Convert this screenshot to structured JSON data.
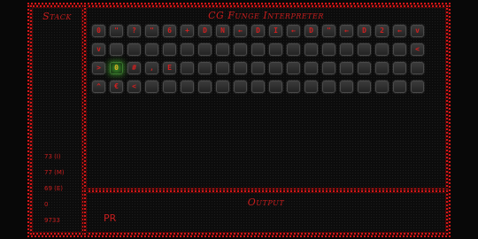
{
  "stack": {
    "title": "Stack",
    "values": [
      "73 (I)",
      "77 (M)",
      "69 (E)",
      "0",
      "9733"
    ]
  },
  "interpreter": {
    "title": "CG Funge Interpreter",
    "rows": [
      [
        "0",
        "\"",
        "?",
        "\"",
        "6",
        "+",
        "D",
        "N",
        "←",
        "D",
        "I",
        "←",
        "D",
        "\"",
        "←",
        "D",
        "2",
        "←",
        "v"
      ],
      [
        "v",
        "",
        "",
        "",
        "",
        "",
        "",
        "",
        "",
        "",
        "",
        "",
        "",
        "",
        "",
        "",
        "",
        "",
        "<"
      ],
      [
        ">",
        "0",
        "#",
        ",",
        "E",
        "",
        "",
        "",
        "",
        "",
        "",
        "",
        "",
        "",
        "",
        "",
        "",
        "",
        ""
      ],
      [
        "^",
        "€",
        "<",
        "",
        "",
        "",
        "",
        "",
        "",
        "",
        "",
        "",
        "",
        "",
        "",
        "",
        "",
        "",
        ""
      ]
    ],
    "cursor": {
      "row": 2,
      "col": 1
    },
    "colors": {
      "accent": "#d31818",
      "cursor": "#3c8a2e",
      "cell": "#2e2e2e"
    }
  },
  "output": {
    "title": "Output",
    "text": "PR"
  }
}
